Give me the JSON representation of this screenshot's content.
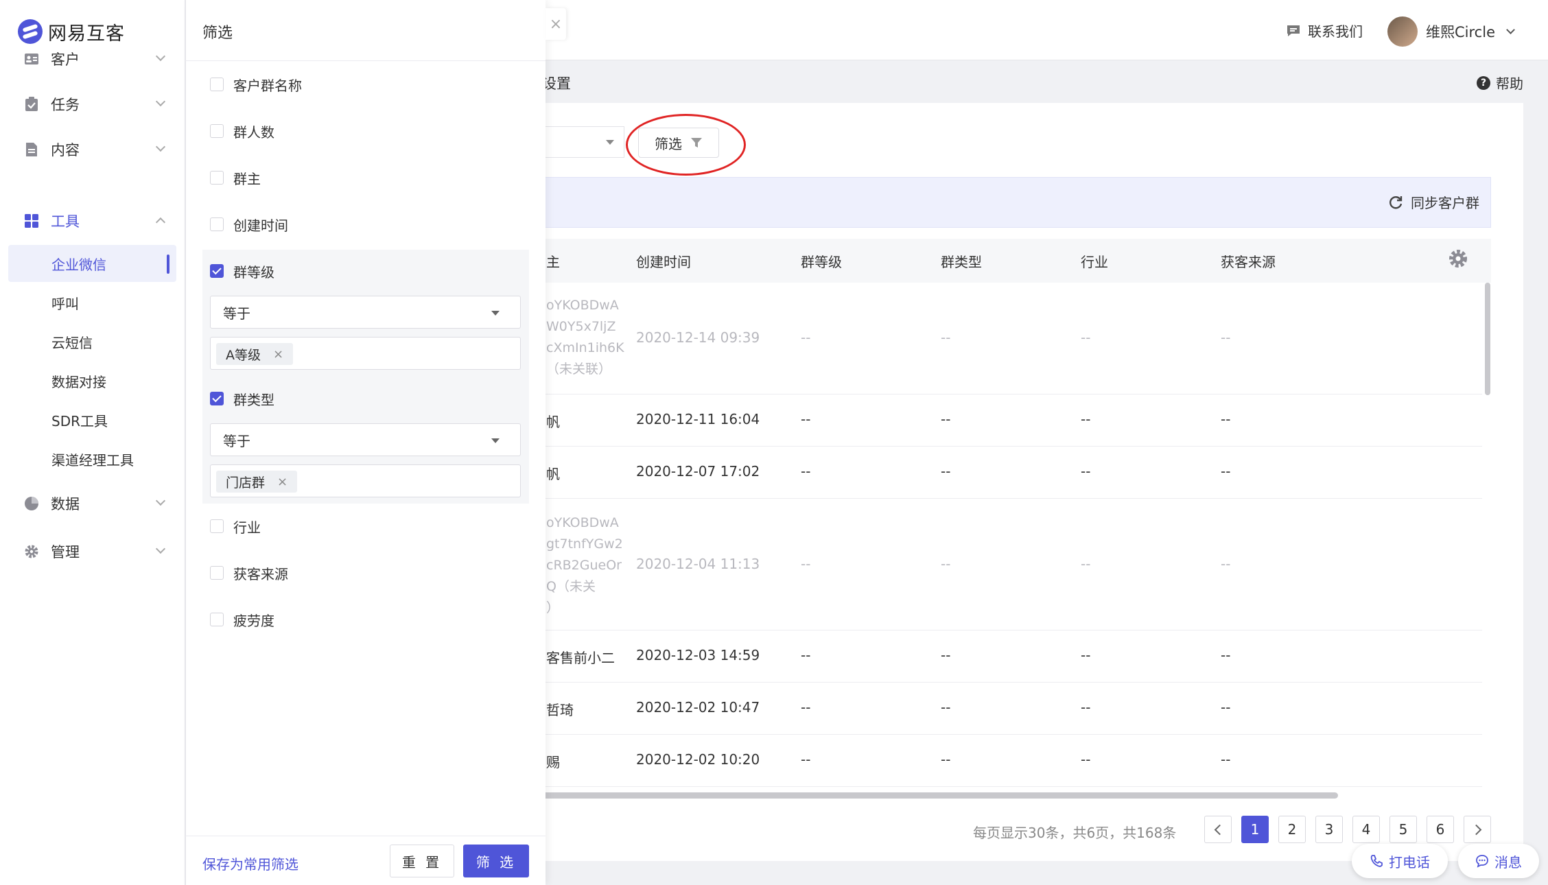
{
  "app": {
    "name": "网易互客"
  },
  "nav": {
    "items": [
      {
        "label": "客户",
        "icon": "contact-card-icon"
      },
      {
        "label": "任务",
        "icon": "task-check-icon"
      },
      {
        "label": "内容",
        "icon": "document-icon"
      },
      {
        "label": "工具",
        "icon": "grid-apps-icon"
      }
    ],
    "tool_sub": [
      "企业微信",
      "呼叫",
      "云短信",
      "数据对接",
      "SDR工具",
      "渠道经理工具"
    ],
    "bottom": [
      {
        "label": "数据",
        "icon": "pie-chart-icon"
      },
      {
        "label": "管理",
        "icon": "gear-icon"
      }
    ]
  },
  "header": {
    "contact_label": "联系我们",
    "user_name": "维熙Circle"
  },
  "subheader": {
    "breadcrumb_tail": "设置",
    "help_label": "帮助"
  },
  "toolbar": {
    "filter_label": "筛选",
    "sync_label": "同步客户群"
  },
  "table": {
    "headers": [
      "主",
      "创建时间",
      "群等级",
      "群类型",
      "行业",
      "获客来源"
    ],
    "rows": [
      {
        "owner_lines": [
          "oYKOBDwA",
          "W0Y5x7ljZ",
          "cXmIn1ih6K",
          "（未关联）"
        ],
        "created": "2020-12-14 09:39",
        "level": "--",
        "type": "--",
        "industry": "--",
        "source": "--"
      },
      {
        "owner": "帆",
        "created": "2020-12-11 16:04",
        "level": "--",
        "type": "--",
        "industry": "--",
        "source": "--"
      },
      {
        "owner": "帆",
        "created": "2020-12-07 17:02",
        "level": "--",
        "type": "--",
        "industry": "--",
        "source": "--"
      },
      {
        "owner_lines": [
          "oYKOBDwA",
          "gt7tnfYGw2",
          "cRB2GueOr",
          "Q（未关",
          "）"
        ],
        "created": "2020-12-04 11:13",
        "level": "--",
        "type": "--",
        "industry": "--",
        "source": "--"
      },
      {
        "owner": "客售前小二",
        "created": "2020-12-03 14:59",
        "level": "--",
        "type": "--",
        "industry": "--",
        "source": "--"
      },
      {
        "owner": "哲琦",
        "created": "2020-12-02 10:47",
        "level": "--",
        "type": "--",
        "industry": "--",
        "source": "--"
      },
      {
        "owner": "赐",
        "created": "2020-12-02 10:20",
        "level": "--",
        "type": "--",
        "industry": "--",
        "source": "--"
      }
    ]
  },
  "pagination": {
    "info": "每页显示30条，共6页，共168条",
    "pages": [
      "1",
      "2",
      "3",
      "4",
      "5",
      "6"
    ],
    "current": "1"
  },
  "float_buttons": {
    "call": "打电话",
    "message": "消息"
  },
  "drawer": {
    "title": "筛选",
    "options": [
      {
        "label": "客户群名称",
        "checked": false
      },
      {
        "label": "群人数",
        "checked": false
      },
      {
        "label": "群主",
        "checked": false
      },
      {
        "label": "创建时间",
        "checked": false
      },
      {
        "label": "群等级",
        "checked": true,
        "operator": "等于",
        "value": "A等级"
      },
      {
        "label": "群类型",
        "checked": true,
        "operator": "等于",
        "value": "门店群"
      },
      {
        "label": "行业",
        "checked": false
      },
      {
        "label": "获客来源",
        "checked": false
      },
      {
        "label": "疲劳度",
        "checked": false
      }
    ],
    "save_label": "保存为常用筛选",
    "reset_label": "重 置",
    "apply_label": "筛 选",
    "close_glyph": "×",
    "tag_remove_glyph": "×"
  },
  "colors": {
    "accent": "#4f55d8",
    "highlight_ring": "#e02424"
  }
}
